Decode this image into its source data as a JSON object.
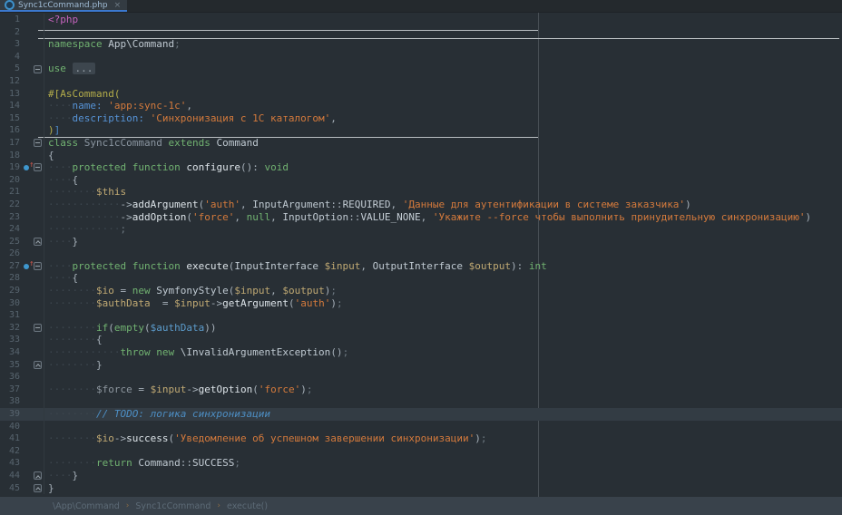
{
  "tab": {
    "title": "Sync1cCommand.php",
    "close_label": "×"
  },
  "breadcrumb": {
    "separator": "›",
    "items": [
      "\\App\\Command",
      "Sync1cCommand",
      "execute()"
    ]
  },
  "colors": {
    "editor_background": "#282F35",
    "tab_underline_accent": "#3B78CE",
    "caret_line_background": "#333C44",
    "keyword_green": "#71B271",
    "string_orange": "#D47A3C",
    "variable_tan": "#C0A973",
    "variable_usage_blue": "#5C9CCC",
    "attribute_yellow": "#B3AC4A",
    "named_argument_blue": "#5693D6",
    "php_tag_magenta": "#C563BD",
    "todo_comment_blue": "#4D8EC3",
    "method_separator_line": "#B9BEC1",
    "right_margin_guide": "#474E54",
    "breadcrumb_background": "#39424B",
    "override_icon_blue": "#3E97CE",
    "override_icon_arrow_red": "#D4594E"
  },
  "editor": {
    "lines": [
      {
        "n": 1,
        "tokens": [
          [
            "<?php",
            "tag"
          ]
        ]
      },
      {
        "n": 2,
        "tokens": []
      },
      {
        "n": 3,
        "tokens": [
          [
            "namespace ",
            "kw"
          ],
          [
            "App\\Command",
            "id"
          ],
          [
            ";",
            "semi"
          ]
        ]
      },
      {
        "n": 4,
        "tokens": []
      },
      {
        "n": 5,
        "fold": "start",
        "tokens": [
          [
            "use ",
            "kw"
          ],
          [
            "...",
            "fchip"
          ]
        ]
      },
      {
        "n": 12,
        "tokens": []
      },
      {
        "n": 13,
        "tokens": [
          [
            "#[AsCommand(",
            "attr"
          ]
        ]
      },
      {
        "n": 14,
        "tokens": [
          [
            "    ",
            "ws"
          ],
          [
            "name: ",
            "narg"
          ],
          [
            "'app:sync-1c'",
            "str"
          ],
          [
            ",",
            "pun"
          ]
        ]
      },
      {
        "n": 15,
        "tokens": [
          [
            "    ",
            "ws"
          ],
          [
            "description: ",
            "narg"
          ],
          [
            "'Синхронизация с 1С каталогом'",
            "str"
          ],
          [
            ",",
            "pun"
          ]
        ]
      },
      {
        "n": 16,
        "tokens": [
          [
            ")",
            "attr"
          ],
          [
            "]",
            "attrb"
          ]
        ]
      },
      {
        "n": 17,
        "fold": "start",
        "tokens": [
          [
            "class ",
            "kw"
          ],
          [
            "Sync1cCommand ",
            "dim"
          ],
          [
            "extends ",
            "kw"
          ],
          [
            "Command",
            "id"
          ]
        ]
      },
      {
        "n": 18,
        "tokens": [
          [
            "{",
            "pun"
          ]
        ]
      },
      {
        "n": 19,
        "icon": "override",
        "fold": "start",
        "tokens": [
          [
            "    ",
            "ws"
          ],
          [
            "protected ",
            "kw"
          ],
          [
            "function ",
            "kw"
          ],
          [
            "configure",
            "meth"
          ],
          [
            "(): ",
            "pun"
          ],
          [
            "void",
            "kw"
          ]
        ]
      },
      {
        "n": 20,
        "tokens": [
          [
            "    ",
            "ws"
          ],
          [
            "{",
            "pun"
          ]
        ]
      },
      {
        "n": 21,
        "tokens": [
          [
            "        ",
            "ws"
          ],
          [
            "$this",
            "var"
          ]
        ]
      },
      {
        "n": 22,
        "tokens": [
          [
            "            ",
            "ws"
          ],
          [
            "->",
            "pun"
          ],
          [
            "addArgument",
            "meth"
          ],
          [
            "(",
            "pun"
          ],
          [
            "'auth'",
            "str"
          ],
          [
            ", ",
            "pun"
          ],
          [
            "InputArgument",
            "id"
          ],
          [
            "::",
            "pun"
          ],
          [
            "REQUIRED",
            "cst"
          ],
          [
            ", ",
            "pun"
          ],
          [
            "'Данные для аутентификации в системе заказчика'",
            "str"
          ],
          [
            ")",
            "pun"
          ]
        ]
      },
      {
        "n": 23,
        "tokens": [
          [
            "            ",
            "ws"
          ],
          [
            "->",
            "pun"
          ],
          [
            "addOption",
            "meth"
          ],
          [
            "(",
            "pun"
          ],
          [
            "'force'",
            "str"
          ],
          [
            ", ",
            "pun"
          ],
          [
            "null",
            "kw"
          ],
          [
            ", ",
            "pun"
          ],
          [
            "InputOption",
            "id"
          ],
          [
            "::",
            "pun"
          ],
          [
            "VALUE_NONE",
            "cst"
          ],
          [
            ", ",
            "pun"
          ],
          [
            "'Укажите --force чтобы выполнить принудительную синхронизацию'",
            "str"
          ],
          [
            ")",
            "pun"
          ]
        ]
      },
      {
        "n": 24,
        "tokens": [
          [
            "            ",
            "ws"
          ],
          [
            ";",
            "semi"
          ]
        ]
      },
      {
        "n": 25,
        "fold": "end",
        "tokens": [
          [
            "    ",
            "ws"
          ],
          [
            "}",
            "pun"
          ]
        ]
      },
      {
        "n": 26,
        "tokens": []
      },
      {
        "n": 27,
        "icon": "override",
        "fold": "start",
        "tokens": [
          [
            "    ",
            "ws"
          ],
          [
            "protected ",
            "kw"
          ],
          [
            "function ",
            "kw"
          ],
          [
            "execute",
            "meth"
          ],
          [
            "(",
            "pun"
          ],
          [
            "InputInterface ",
            "id"
          ],
          [
            "$input",
            "var"
          ],
          [
            ", ",
            "pun"
          ],
          [
            "OutputInterface ",
            "id"
          ],
          [
            "$output",
            "var"
          ],
          [
            "): ",
            "pun"
          ],
          [
            "int",
            "kw"
          ]
        ]
      },
      {
        "n": 28,
        "tokens": [
          [
            "    ",
            "ws"
          ],
          [
            "{",
            "pun"
          ]
        ]
      },
      {
        "n": 29,
        "tokens": [
          [
            "        ",
            "ws"
          ],
          [
            "$io",
            "var"
          ],
          [
            " = ",
            "pun"
          ],
          [
            "new ",
            "kw"
          ],
          [
            "SymfonyStyle",
            "id"
          ],
          [
            "(",
            "pun"
          ],
          [
            "$input",
            "var"
          ],
          [
            ", ",
            "pun"
          ],
          [
            "$output",
            "var"
          ],
          [
            ")",
            "pun"
          ],
          [
            ";",
            "semi"
          ]
        ]
      },
      {
        "n": 30,
        "tokens": [
          [
            "        ",
            "ws"
          ],
          [
            "$authData",
            "var"
          ],
          [
            "  = ",
            "pun"
          ],
          [
            "$input",
            "var"
          ],
          [
            "->",
            "pun"
          ],
          [
            "getArgument",
            "meth"
          ],
          [
            "(",
            "pun"
          ],
          [
            "'auth'",
            "str"
          ],
          [
            ")",
            "pun"
          ],
          [
            ";",
            "semi"
          ]
        ]
      },
      {
        "n": 31,
        "tokens": []
      },
      {
        "n": 32,
        "fold": "start",
        "tokens": [
          [
            "        ",
            "ws"
          ],
          [
            "if",
            "kw"
          ],
          [
            "(",
            "pun"
          ],
          [
            "empty",
            "kw"
          ],
          [
            "(",
            "pun"
          ],
          [
            "$authData",
            "varb"
          ],
          [
            "))",
            "pun"
          ]
        ]
      },
      {
        "n": 33,
        "tokens": [
          [
            "        ",
            "ws"
          ],
          [
            "{",
            "pun"
          ]
        ]
      },
      {
        "n": 34,
        "tokens": [
          [
            "            ",
            "ws"
          ],
          [
            "throw ",
            "kw"
          ],
          [
            "new ",
            "kw"
          ],
          [
            "\\InvalidArgumentException",
            "id"
          ],
          [
            "()",
            "pun"
          ],
          [
            ";",
            "semi"
          ]
        ]
      },
      {
        "n": 35,
        "fold": "end",
        "tokens": [
          [
            "        ",
            "ws"
          ],
          [
            "}",
            "pun"
          ]
        ]
      },
      {
        "n": 36,
        "tokens": []
      },
      {
        "n": 37,
        "tokens": [
          [
            "        ",
            "ws"
          ],
          [
            "$force",
            "vdim"
          ],
          [
            " = ",
            "pun"
          ],
          [
            "$input",
            "var"
          ],
          [
            "->",
            "pun"
          ],
          [
            "getOption",
            "meth"
          ],
          [
            "(",
            "pun"
          ],
          [
            "'force'",
            "str"
          ],
          [
            ")",
            "pun"
          ],
          [
            ";",
            "semi"
          ]
        ]
      },
      {
        "n": 38,
        "tokens": []
      },
      {
        "n": 39,
        "caret": true,
        "tokens": [
          [
            "        ",
            "ws"
          ],
          [
            "// TODO: логика синхронизации",
            "cmt"
          ]
        ]
      },
      {
        "n": 40,
        "tokens": []
      },
      {
        "n": 41,
        "tokens": [
          [
            "        ",
            "ws"
          ],
          [
            "$io",
            "var"
          ],
          [
            "->",
            "pun"
          ],
          [
            "success",
            "meth"
          ],
          [
            "(",
            "pun"
          ],
          [
            "'Уведомление об успешном завершении синхронизации'",
            "str"
          ],
          [
            ")",
            "pun"
          ],
          [
            ";",
            "semi"
          ]
        ]
      },
      {
        "n": 42,
        "tokens": []
      },
      {
        "n": 43,
        "tokens": [
          [
            "        ",
            "ws"
          ],
          [
            "return ",
            "kw"
          ],
          [
            "Command",
            "id"
          ],
          [
            "::",
            "pun"
          ],
          [
            "SUCCESS",
            "cst"
          ],
          [
            ";",
            "semi"
          ]
        ]
      },
      {
        "n": 44,
        "fold": "end",
        "tokens": [
          [
            "    ",
            "ws"
          ],
          [
            "}",
            "pun"
          ]
        ]
      },
      {
        "n": 45,
        "fold": "end",
        "tokens": [
          [
            "}",
            "pun"
          ]
        ]
      }
    ]
  }
}
